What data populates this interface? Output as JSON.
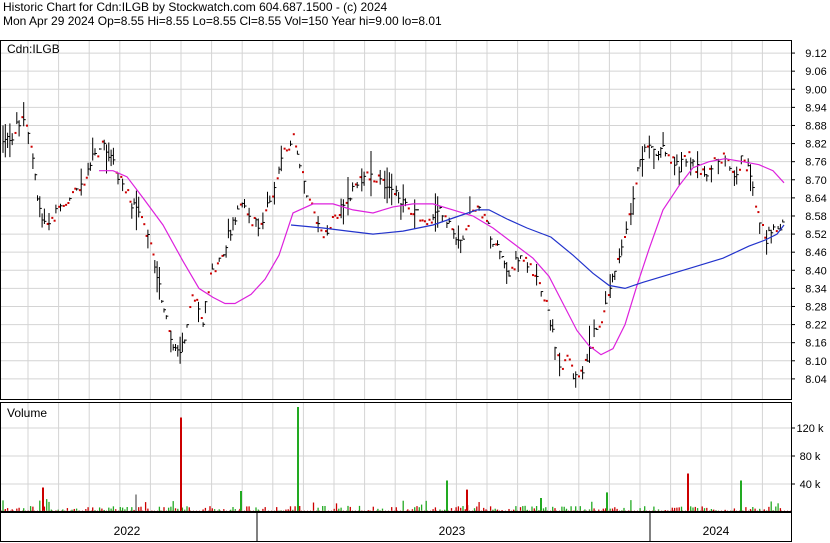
{
  "header": {
    "line1": "Historic Chart for Cdn:ILGB by Stockwatch.com 604.687.1500 - (c) 2024",
    "line2": "Mon Apr 29 2024  Op=8.55  Hi=8.55  Lo=8.55  Cl=8.55  Vol=150  Year hi=9.00  lo=8.01"
  },
  "colors": {
    "price_bar": "#000000",
    "close_dot": "#cc0000",
    "ma_short": "#dd22dd",
    "ma_long": "#2233cc",
    "volume_up": "#22aa22",
    "volume_down": "#cc0000",
    "volume_flat": "#999999",
    "grid": "#d4d4d4",
    "frame": "#000000"
  },
  "chart_data": [
    {
      "type": "line",
      "panel": "price",
      "label": "Cdn:ILGB",
      "ylim": [
        7.97,
        9.16
      ],
      "y_ticks": [
        "9.12",
        "9.06",
        "9.00",
        "8.94",
        "8.88",
        "8.82",
        "8.76",
        "8.70",
        "8.64",
        "8.58",
        "8.52",
        "8.46",
        "8.40",
        "8.34",
        "8.28",
        "8.22",
        "8.16",
        "8.10",
        "8.04"
      ],
      "x_labels": [
        "2022",
        "2023",
        "2024"
      ],
      "price_path": [
        [
          0,
          8.82
        ],
        [
          10,
          8.85
        ],
        [
          20,
          8.92
        ],
        [
          30,
          8.78
        ],
        [
          38,
          8.56
        ],
        [
          46,
          8.55
        ],
        [
          56,
          8.6
        ],
        [
          66,
          8.64
        ],
        [
          76,
          8.66
        ],
        [
          90,
          8.78
        ],
        [
          100,
          8.82
        ],
        [
          110,
          8.76
        ],
        [
          120,
          8.68
        ],
        [
          128,
          8.62
        ],
        [
          136,
          8.58
        ],
        [
          144,
          8.52
        ],
        [
          152,
          8.42
        ],
        [
          158,
          8.32
        ],
        [
          164,
          8.22
        ],
        [
          170,
          8.14
        ],
        [
          176,
          8.12
        ],
        [
          182,
          8.18
        ],
        [
          188,
          8.3
        ],
        [
          194,
          8.28
        ],
        [
          200,
          8.22
        ],
        [
          206,
          8.36
        ],
        [
          212,
          8.42
        ],
        [
          218,
          8.44
        ],
        [
          224,
          8.5
        ],
        [
          230,
          8.56
        ],
        [
          236,
          8.62
        ],
        [
          242,
          8.6
        ],
        [
          250,
          8.56
        ],
        [
          258,
          8.54
        ],
        [
          266,
          8.62
        ],
        [
          274,
          8.72
        ],
        [
          282,
          8.8
        ],
        [
          290,
          8.84
        ],
        [
          296,
          8.76
        ],
        [
          304,
          8.66
        ],
        [
          312,
          8.58
        ],
        [
          320,
          8.52
        ],
        [
          328,
          8.56
        ],
        [
          336,
          8.6
        ],
        [
          344,
          8.62
        ],
        [
          352,
          8.68
        ],
        [
          360,
          8.7
        ],
        [
          368,
          8.72
        ],
        [
          376,
          8.7
        ],
        [
          384,
          8.68
        ],
        [
          392,
          8.66
        ],
        [
          400,
          8.62
        ],
        [
          408,
          8.6
        ],
        [
          416,
          8.58
        ],
        [
          424,
          8.56
        ],
        [
          432,
          8.58
        ],
        [
          440,
          8.6
        ],
        [
          448,
          8.54
        ],
        [
          456,
          8.48
        ],
        [
          464,
          8.56
        ],
        [
          472,
          8.62
        ],
        [
          480,
          8.58
        ],
        [
          488,
          8.52
        ],
        [
          496,
          8.46
        ],
        [
          504,
          8.38
        ],
        [
          512,
          8.42
        ],
        [
          520,
          8.44
        ],
        [
          528,
          8.4
        ],
        [
          536,
          8.36
        ],
        [
          544,
          8.28
        ],
        [
          552,
          8.16
        ],
        [
          558,
          8.08
        ],
        [
          564,
          8.1
        ],
        [
          570,
          8.06
        ],
        [
          576,
          8.04
        ],
        [
          584,
          8.1
        ],
        [
          592,
          8.2
        ],
        [
          598,
          8.24
        ],
        [
          604,
          8.3
        ],
        [
          610,
          8.38
        ],
        [
          616,
          8.44
        ],
        [
          622,
          8.52
        ],
        [
          628,
          8.6
        ],
        [
          634,
          8.72
        ],
        [
          640,
          8.78
        ],
        [
          646,
          8.82
        ],
        [
          652,
          8.78
        ],
        [
          660,
          8.8
        ],
        [
          668,
          8.76
        ],
        [
          676,
          8.74
        ],
        [
          684,
          8.78
        ],
        [
          692,
          8.74
        ],
        [
          700,
          8.72
        ],
        [
          708,
          8.74
        ],
        [
          716,
          8.78
        ],
        [
          724,
          8.76
        ],
        [
          732,
          8.72
        ],
        [
          740,
          8.78
        ],
        [
          746,
          8.72
        ],
        [
          752,
          8.62
        ],
        [
          758,
          8.54
        ],
        [
          764,
          8.5
        ],
        [
          770,
          8.56
        ],
        [
          776,
          8.52
        ],
        [
          781,
          8.55
        ]
      ],
      "series": [
        {
          "key": "ma_short",
          "points": [
            [
              96,
              8.73
            ],
            [
              110,
              8.73
            ],
            [
              124,
              8.71
            ],
            [
              140,
              8.64
            ],
            [
              160,
              8.55
            ],
            [
              180,
              8.43
            ],
            [
              196,
              8.34
            ],
            [
              210,
              8.31
            ],
            [
              222,
              8.29
            ],
            [
              232,
              8.29
            ],
            [
              248,
              8.32
            ],
            [
              262,
              8.37
            ],
            [
              276,
              8.45
            ],
            [
              290,
              8.59
            ],
            [
              310,
              8.62
            ],
            [
              330,
              8.62
            ],
            [
              350,
              8.6
            ],
            [
              370,
              8.59
            ],
            [
              390,
              8.61
            ],
            [
              410,
              8.62
            ],
            [
              430,
              8.62
            ],
            [
              450,
              8.6
            ],
            [
              470,
              8.58
            ],
            [
              490,
              8.54
            ],
            [
              510,
              8.49
            ],
            [
              530,
              8.44
            ],
            [
              546,
              8.38
            ],
            [
              560,
              8.29
            ],
            [
              574,
              8.2
            ],
            [
              586,
              8.15
            ],
            [
              598,
              8.12
            ],
            [
              610,
              8.14
            ],
            [
              622,
              8.22
            ],
            [
              634,
              8.35
            ],
            [
              646,
              8.47
            ],
            [
              660,
              8.6
            ],
            [
              676,
              8.68
            ],
            [
              690,
              8.74
            ],
            [
              706,
              8.76
            ],
            [
              722,
              8.77
            ],
            [
              740,
              8.76
            ],
            [
              756,
              8.75
            ],
            [
              770,
              8.73
            ],
            [
              781,
              8.69
            ]
          ]
        },
        {
          "key": "ma_long",
          "points": [
            [
              288,
              8.55
            ],
            [
              320,
              8.54
            ],
            [
              345,
              8.53
            ],
            [
              370,
              8.52
            ],
            [
              400,
              8.53
            ],
            [
              430,
              8.55
            ],
            [
              456,
              8.58
            ],
            [
              474,
              8.6
            ],
            [
              486,
              8.6
            ],
            [
              504,
              8.57
            ],
            [
              524,
              8.54
            ],
            [
              548,
              8.51
            ],
            [
              570,
              8.45
            ],
            [
              590,
              8.39
            ],
            [
              606,
              8.35
            ],
            [
              622,
              8.34
            ],
            [
              640,
              8.36
            ],
            [
              660,
              8.38
            ],
            [
              690,
              8.41
            ],
            [
              720,
              8.44
            ],
            [
              746,
              8.48
            ],
            [
              762,
              8.5
            ],
            [
              774,
              8.52
            ],
            [
              781,
              8.55
            ]
          ]
        }
      ]
    },
    {
      "type": "bar",
      "panel": "volume",
      "label": "Volume",
      "ylim": [
        0,
        150
      ],
      "y_ticks": [
        "120 k",
        "80 k",
        "40 k"
      ],
      "y_tick_values": [
        120,
        80,
        40
      ],
      "spikes": [
        [
          40,
          35,
          "down"
        ],
        [
          133,
          25,
          "flat"
        ],
        [
          178,
          135,
          "down"
        ],
        [
          238,
          30,
          "up"
        ],
        [
          295,
          150,
          "up"
        ],
        [
          444,
          45,
          "up"
        ],
        [
          464,
          32,
          "down"
        ],
        [
          538,
          20,
          "up"
        ],
        [
          604,
          28,
          "up"
        ],
        [
          685,
          55,
          "down"
        ],
        [
          738,
          45,
          "up"
        ]
      ]
    }
  ]
}
